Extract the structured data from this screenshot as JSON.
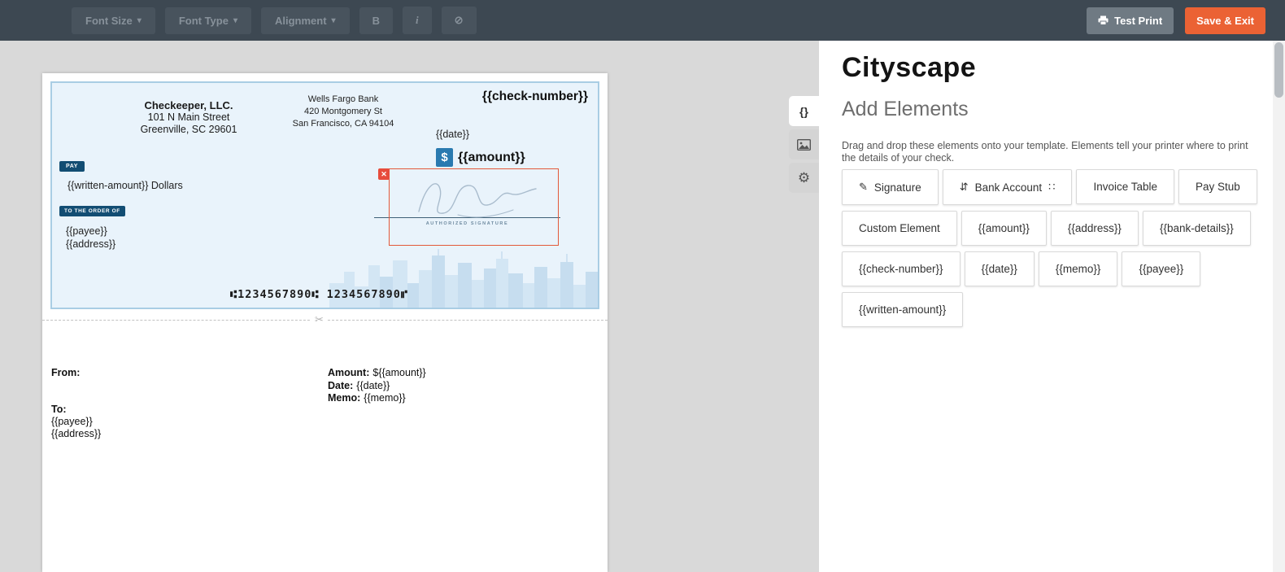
{
  "toolbar": {
    "font_size_label": "Font Size",
    "font_type_label": "Font Type",
    "alignment_label": "Alignment",
    "bold_label": "B",
    "italic_label": "i",
    "test_print_label": "Test Print",
    "save_exit_label": "Save & Exit"
  },
  "icons": {
    "caret": "▾",
    "clear": "⊘",
    "dollar": "$",
    "close": "✕",
    "scissors": "✂",
    "gear": "⚙",
    "code_tab": "{}",
    "pen": "✎",
    "bank": "⇵",
    "drag_handle": "∷"
  },
  "check": {
    "company": {
      "name": "Checkeeper, LLC.",
      "address1": "101 N Main Street",
      "address2": "Greenville, SC 29601"
    },
    "bank": {
      "name": "Wells Fargo Bank",
      "address1": "420 Montgomery St",
      "address2": "San Francisco, CA 94104"
    },
    "check_number": "{{check-number}}",
    "date": "{{date}}",
    "amount": "{{amount}}",
    "pay_label": "PAY",
    "written_amount": "{{written-amount}} Dollars",
    "to_order_label": "TO THE ORDER OF",
    "payee": "{{payee}}",
    "address": "{{address}}",
    "authorized_signature_label": "AUTHORIZED SIGNATURE",
    "micr": "⑆1234567890⑆  1234567890⑈"
  },
  "stub": {
    "from_label": "From:",
    "to_label": "To:",
    "payee": "{{payee}}",
    "address": "{{address}}",
    "amount_label": "Amount:",
    "amount_value": "${{amount}}",
    "date_label": "Date:",
    "date_value": "{{date}}",
    "memo_label": "Memo:",
    "memo_value": "{{memo}}"
  },
  "sidebar": {
    "title": "Cityscape",
    "heading": "Add Elements",
    "description": "Drag and drop these elements onto your template. Elements tell your printer where to print the details of your check.",
    "elements": [
      {
        "label": "Signature"
      },
      {
        "label": "Bank Account"
      },
      {
        "label": "Invoice Table"
      },
      {
        "label": "Pay Stub"
      },
      {
        "label": "Custom Element"
      },
      {
        "label": "{{amount}}"
      },
      {
        "label": "{{address}}"
      },
      {
        "label": "{{bank-details}}"
      },
      {
        "label": "{{check-number}}"
      },
      {
        "label": "{{date}}"
      },
      {
        "label": "{{memo}}"
      },
      {
        "label": "{{payee}}"
      },
      {
        "label": "{{written-amount}}"
      }
    ]
  },
  "colors": {
    "topbar": "#3d4852",
    "accent_orange": "#eb6234",
    "check_blue": "#e9f3fb",
    "badge_navy": "#124d73",
    "selection_red": "#e2593a"
  }
}
